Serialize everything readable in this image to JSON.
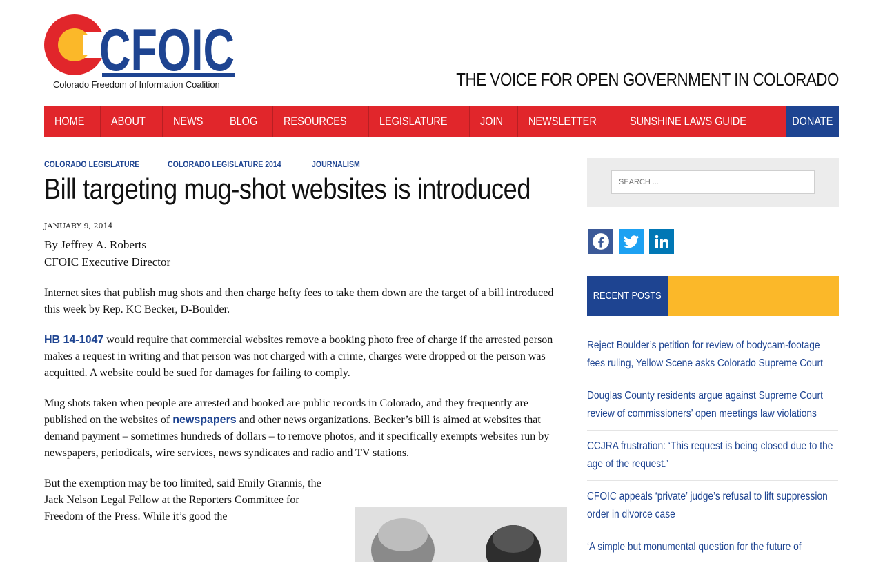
{
  "header": {
    "logo_text": "CFOIC",
    "logo_subtitle": "Colorado Freedom of Information Coalition",
    "tagline": "THE VOICE FOR OPEN GOVERNMENT IN COLORADO"
  },
  "nav": {
    "items": [
      "HOME",
      "ABOUT",
      "NEWS",
      "BLOG",
      "RESOURCES",
      "LEGISLATURE",
      "JOIN",
      "NEWSLETTER",
      "SUNSHINE LAWS GUIDE"
    ],
    "donate": "DONATE"
  },
  "article": {
    "categories": [
      "COLORADO LEGISLATURE",
      "COLORADO LEGISLATURE 2014",
      "JOURNALISM"
    ],
    "title": "Bill targeting mug-shot websites is introduced",
    "date": "JANUARY 9, 2014",
    "byline": "By Jeffrey A. Roberts",
    "byline_role": "CFOIC Executive Director",
    "p1": "Internet sites that publish mug shots and then charge hefty fees to take them down are the target of a bill introduced this week by Rep. KC Becker, D-Boulder.",
    "p2_link": "HB 14-1047",
    "p2": " would require that commercial websites remove a booking photo free of charge if the arrested person makes a request in writing and that person was not charged with a crime, charges were dropped or the person was acquitted. A website could be sued for damages for failing to comply.",
    "p3_a": "Mug shots taken when people are arrested and booked are public records in Colorado, and they frequently are published on the websites of ",
    "p3_link": "newspapers",
    "p3_b": " and other news organizations.  Becker’s bill is aimed at websites that demand payment – sometimes hundreds of dollars – to remove photos, and it specifically exempts websites run by newspapers, periodicals, wire services, news syndicates and radio and TV stations.",
    "p4": "But the exemption may be too limited, said Emily Grannis, the Jack Nelson Legal Fellow at the Reporters Committee for Freedom of the Press. While it’s good the"
  },
  "sidebar": {
    "search_placeholder": "SEARCH ...",
    "social": [
      "facebook-icon",
      "twitter-icon",
      "linkedin-icon"
    ],
    "recent_label": "RECENT POSTS",
    "recent_posts": [
      "Reject Boulder’s petition for review of bodycam-footage fees ruling, Yellow Scene asks Colorado Supreme Court",
      "Douglas County residents argue against Supreme Court review of commissioners’ open meetings law violations",
      "CCJRA frustration: ‘This request is being closed due to the age of the request.’",
      "CFOIC appeals ‘private’ judge’s refusal to lift suppression order in divorce case",
      "‘A simple but monumental question for the future of"
    ]
  },
  "colors": {
    "red": "#e1262b",
    "blue": "#1e4491",
    "yellow": "#fbb829"
  }
}
